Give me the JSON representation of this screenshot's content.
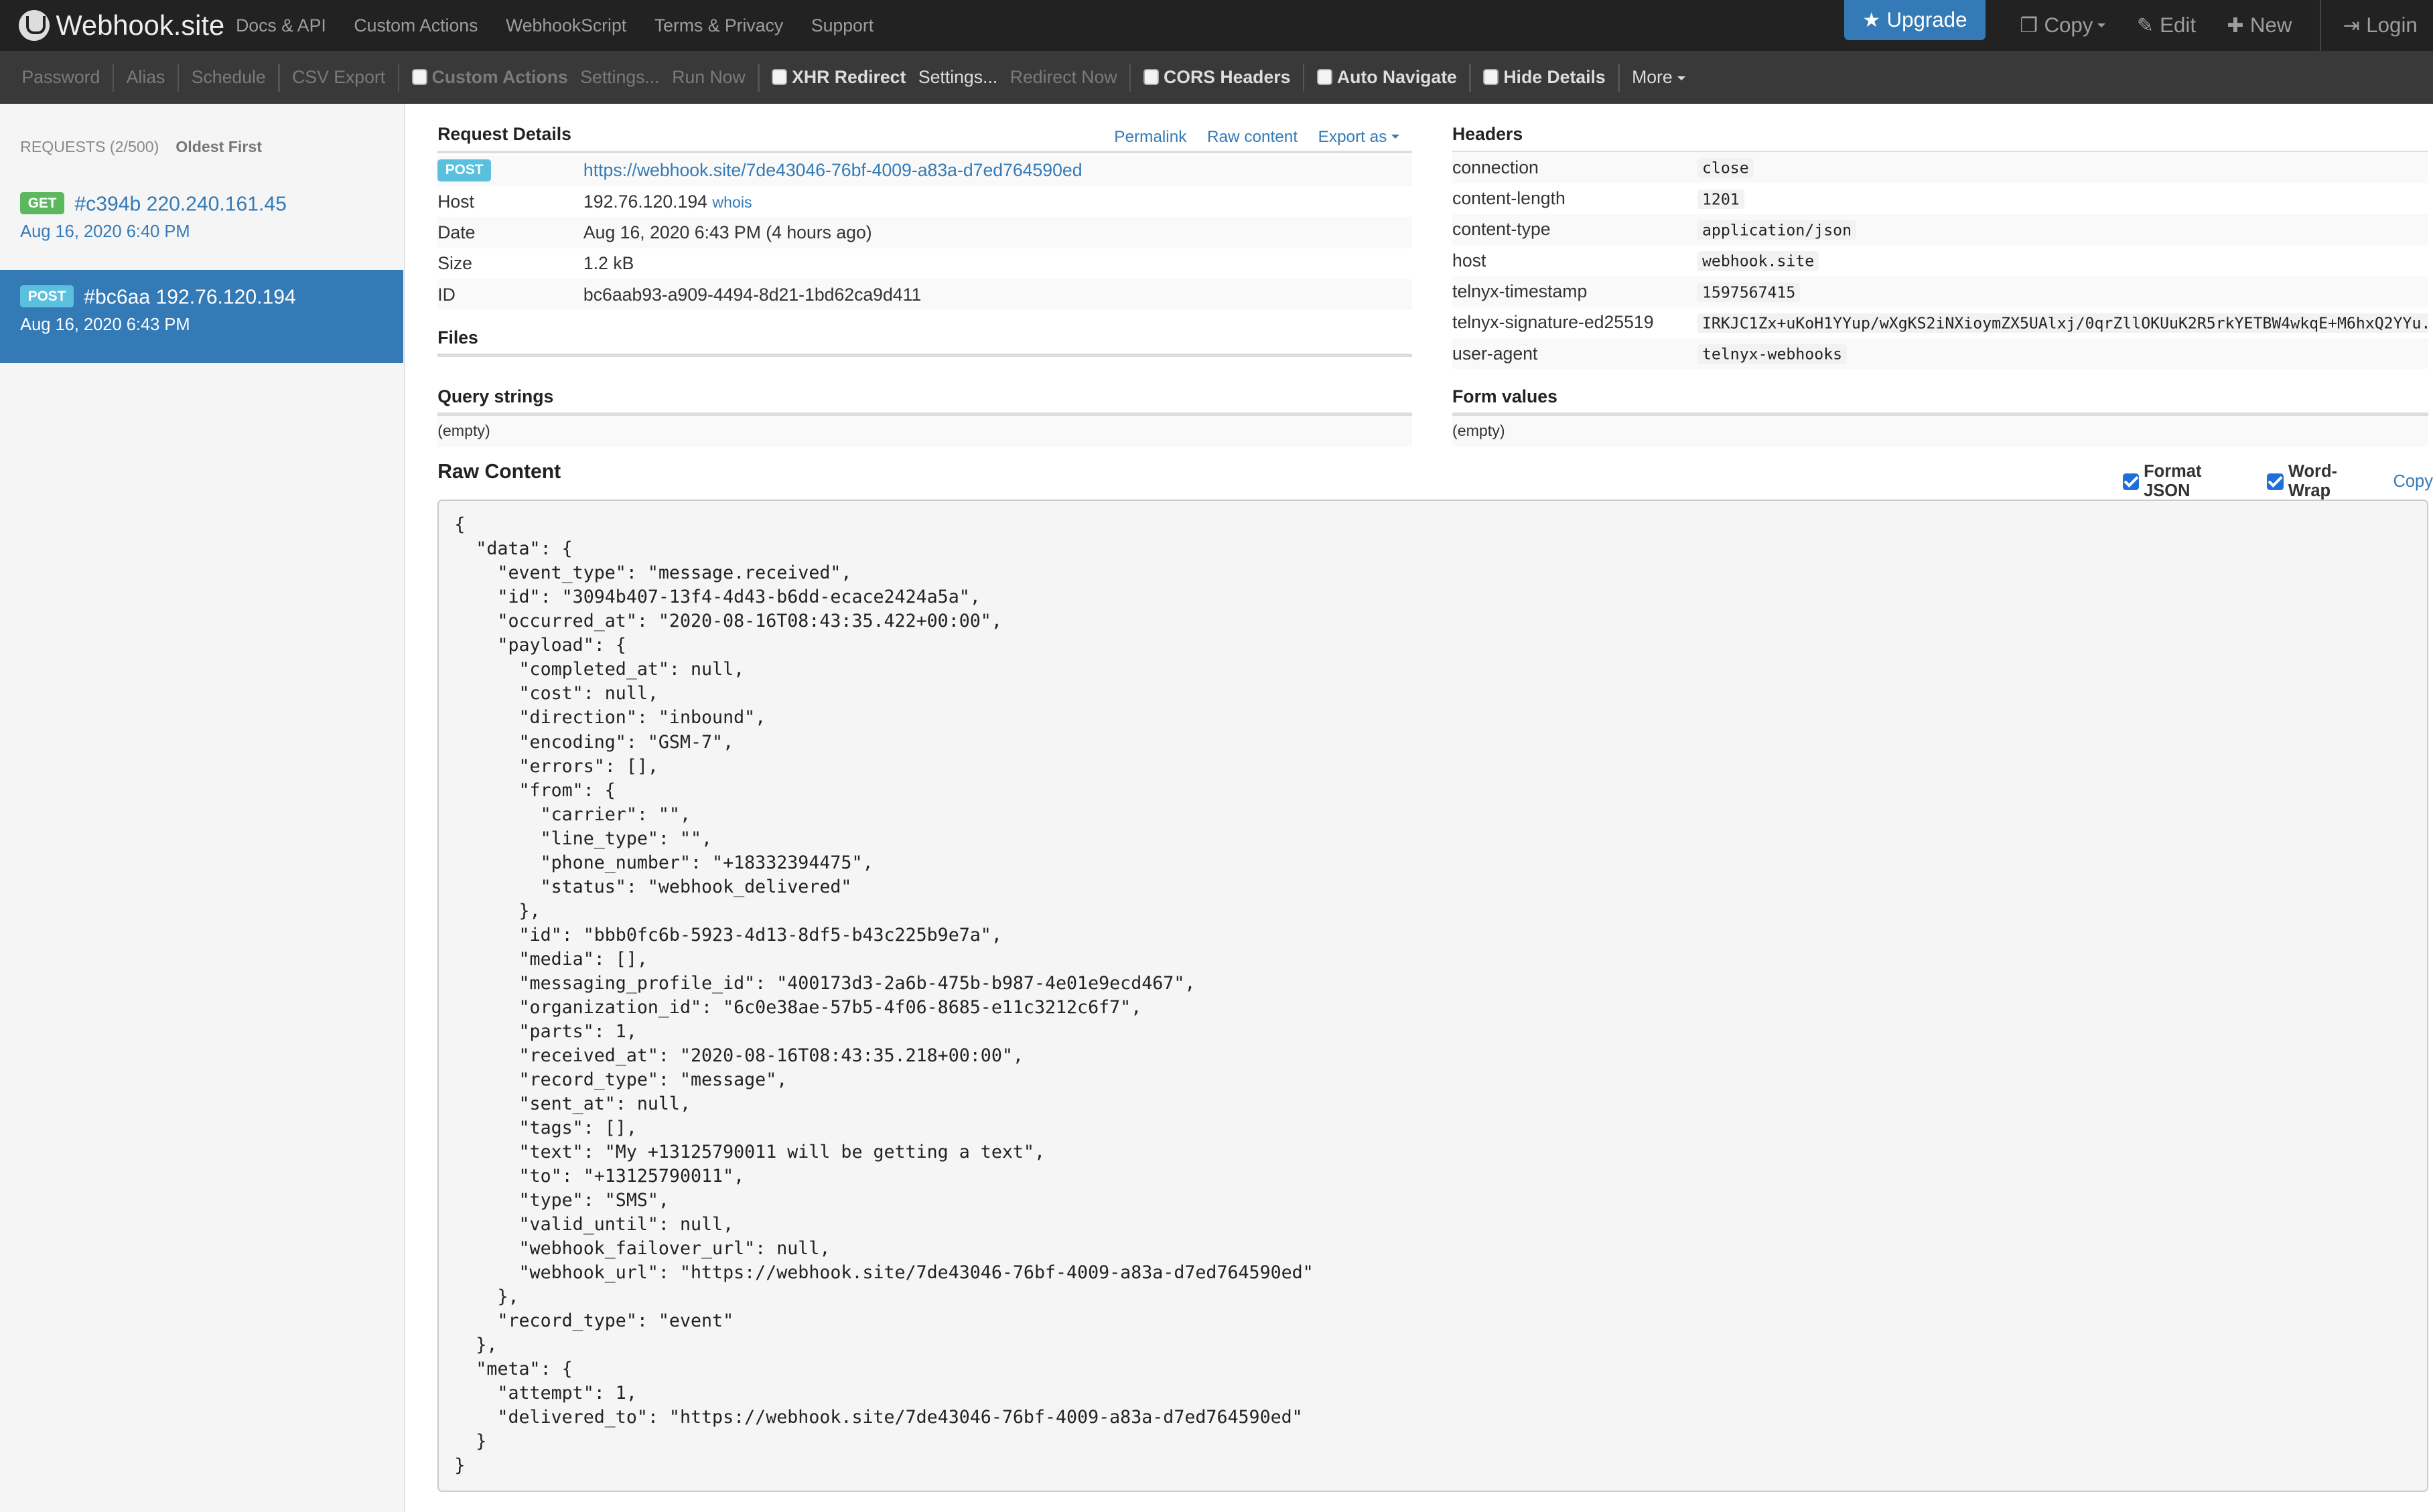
{
  "navbar": {
    "brand": "Webhook.site",
    "links": [
      "Docs & API",
      "Custom Actions",
      "WebhookScript",
      "Terms & Privacy",
      "Support"
    ],
    "upgrade": "Upgrade",
    "copy": "Copy",
    "edit": "Edit",
    "new": "New",
    "login": "Login",
    "icons": {
      "upgrade": "star-icon",
      "copy": "copy-icon",
      "edit": "edit-icon",
      "new": "plus-icon",
      "login": "login-icon"
    }
  },
  "toolbar": {
    "password": "Password",
    "alias": "Alias",
    "schedule": "Schedule",
    "csv_export": "CSV Export",
    "custom_actions": "Custom Actions",
    "custom_settings": "Settings...",
    "run_now": "Run Now",
    "xhr_redirect": "XHR Redirect",
    "xhr_settings": "Settings...",
    "redirect_now": "Redirect Now",
    "cors_headers": "CORS Headers",
    "auto_navigate": "Auto Navigate",
    "hide_details": "Hide Details",
    "more": "More"
  },
  "sidebar": {
    "requests_label": "REQUESTS (2/500)",
    "oldest_first": "Oldest First",
    "requests": [
      {
        "method": "GET",
        "id": "#c394b",
        "ip": "220.240.161.45",
        "date": "Aug 16, 2020 6:40 PM"
      },
      {
        "method": "POST",
        "id": "#bc6aa",
        "ip": "192.76.120.194",
        "date": "Aug 16, 2020 6:43 PM"
      }
    ]
  },
  "details": {
    "title": "Request Details",
    "permalink": "Permalink",
    "raw_content": "Raw content",
    "export_as": "Export as",
    "method": "POST",
    "url": "https://webhook.site/7de43046-76bf-4009-a83a-d7ed764590ed",
    "host_label": "Host",
    "host": "192.76.120.194",
    "whois": "whois",
    "date_label": "Date",
    "date": "Aug 16, 2020 6:43 PM (4 hours ago)",
    "size_label": "Size",
    "size": "1.2 kB",
    "id_label": "ID",
    "id": "bc6aab93-a909-4494-8d21-1bd62ca9d411"
  },
  "files": {
    "title": "Files"
  },
  "query": {
    "title": "Query strings",
    "empty": "(empty)"
  },
  "headers": {
    "title": "Headers",
    "rows": [
      {
        "k": "connection",
        "v": "close"
      },
      {
        "k": "content-length",
        "v": "1201"
      },
      {
        "k": "content-type",
        "v": "application/json"
      },
      {
        "k": "host",
        "v": "webhook.site"
      },
      {
        "k": "telnyx-timestamp",
        "v": "1597567415"
      },
      {
        "k": "telnyx-signature-ed25519",
        "v": "IRKJC1Zx+uKoH1YYup/wXgKS2iNXioymZX5UAlxj/0qrZllOKUuK2R5rkYETBW4wkqE+M6hxQ2YYu..."
      },
      {
        "k": "user-agent",
        "v": "telnyx-webhooks"
      }
    ]
  },
  "form": {
    "title": "Form values",
    "empty": "(empty)"
  },
  "raw": {
    "title": "Raw Content",
    "format_json": "Format JSON",
    "word_wrap": "Word-Wrap",
    "copy": "Copy",
    "body": "{\n  \"data\": {\n    \"event_type\": \"message.received\",\n    \"id\": \"3094b407-13f4-4d43-b6dd-ecace2424a5a\",\n    \"occurred_at\": \"2020-08-16T08:43:35.422+00:00\",\n    \"payload\": {\n      \"completed_at\": null,\n      \"cost\": null,\n      \"direction\": \"inbound\",\n      \"encoding\": \"GSM-7\",\n      \"errors\": [],\n      \"from\": {\n        \"carrier\": \"\",\n        \"line_type\": \"\",\n        \"phone_number\": \"+18332394475\",\n        \"status\": \"webhook_delivered\"\n      },\n      \"id\": \"bbb0fc6b-5923-4d13-8df5-b43c225b9e7a\",\n      \"media\": [],\n      \"messaging_profile_id\": \"400173d3-2a6b-475b-b987-4e01e9ecd467\",\n      \"organization_id\": \"6c0e38ae-57b5-4f06-8685-e11c3212c6f7\",\n      \"parts\": 1,\n      \"received_at\": \"2020-08-16T08:43:35.218+00:00\",\n      \"record_type\": \"message\",\n      \"sent_at\": null,\n      \"tags\": [],\n      \"text\": \"My +13125790011 will be getting a text\",\n      \"to\": \"+13125790011\",\n      \"type\": \"SMS\",\n      \"valid_until\": null,\n      \"webhook_failover_url\": null,\n      \"webhook_url\": \"https://webhook.site/7de43046-76bf-4009-a83a-d7ed764590ed\"\n    },\n    \"record_type\": \"event\"\n  },\n  \"meta\": {\n    \"attempt\": 1,\n    \"delivered_to\": \"https://webhook.site/7de43046-76bf-4009-a83a-d7ed764590ed\"\n  }\n}"
  },
  "colors": {
    "navbar": "#222222",
    "toolbar": "#393939",
    "accent": "#337ab7",
    "get_badge": "#5cb85c",
    "post_badge": "#5bc0de"
  }
}
